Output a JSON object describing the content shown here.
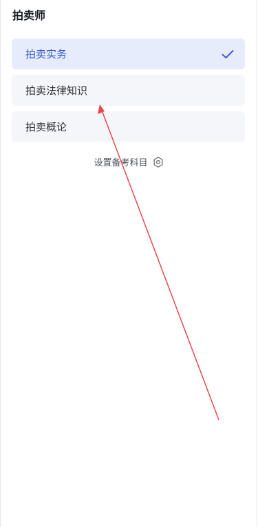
{
  "header": {
    "title": "拍卖师"
  },
  "subjects": [
    {
      "label": "拍卖实务",
      "selected": true
    },
    {
      "label": "拍卖法律知识",
      "selected": false
    },
    {
      "label": "拍卖概论",
      "selected": false
    }
  ],
  "settings": {
    "label": "设置备考科目",
    "icon": "gear-icon"
  },
  "colors": {
    "accent": "#3b5bd0",
    "selected_bg": "#e6ecfb",
    "item_bg": "#f5f6fa",
    "annotation_arrow": "#e5484d"
  }
}
